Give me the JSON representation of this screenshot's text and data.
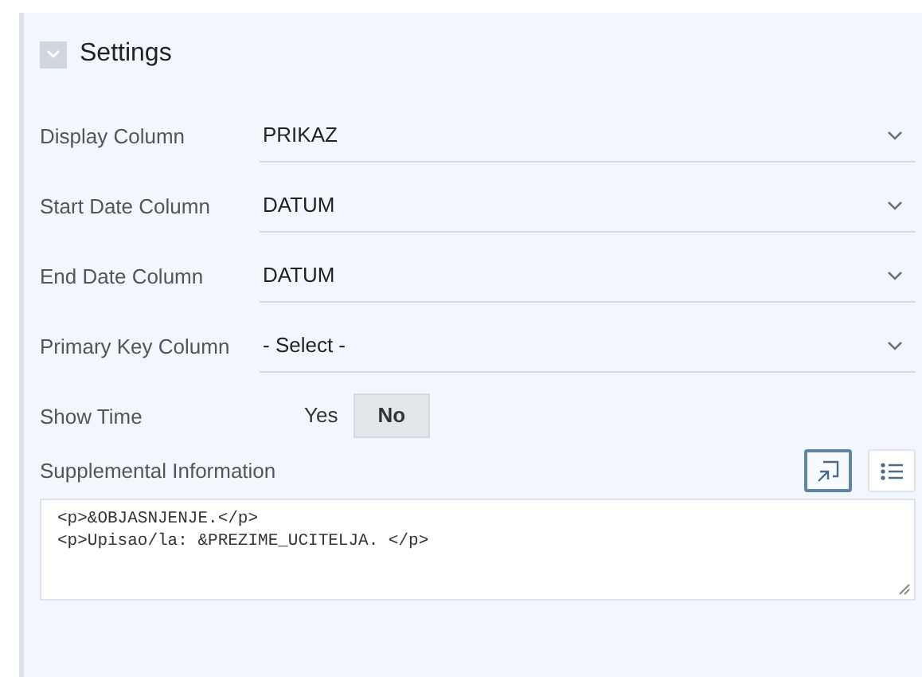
{
  "section": {
    "title": "Settings",
    "expanded": true
  },
  "fields": [
    {
      "kind": "select",
      "label": "Display Column",
      "value": "PRIKAZ"
    },
    {
      "kind": "select",
      "label": "Start Date Column",
      "value": "DATUM"
    },
    {
      "kind": "select",
      "label": "End Date Column",
      "value": "DATUM"
    },
    {
      "kind": "select",
      "label": "Primary Key Column",
      "value": "- Select -"
    },
    {
      "kind": "toggle",
      "label": "Show Time",
      "options": [
        {
          "label": "Yes",
          "selected": false
        },
        {
          "label": "No",
          "selected": true
        }
      ]
    }
  ],
  "supplemental": {
    "label": "Supplemental Information",
    "tools": [
      {
        "kind": "expand",
        "selected": true
      },
      {
        "kind": "list",
        "selected": false
      }
    ],
    "lines": [
      "<p>&OBJASNJENJE.</p>",
      "<p>Upisao/la: &PREZIME_UCITELJA. </p>"
    ]
  }
}
